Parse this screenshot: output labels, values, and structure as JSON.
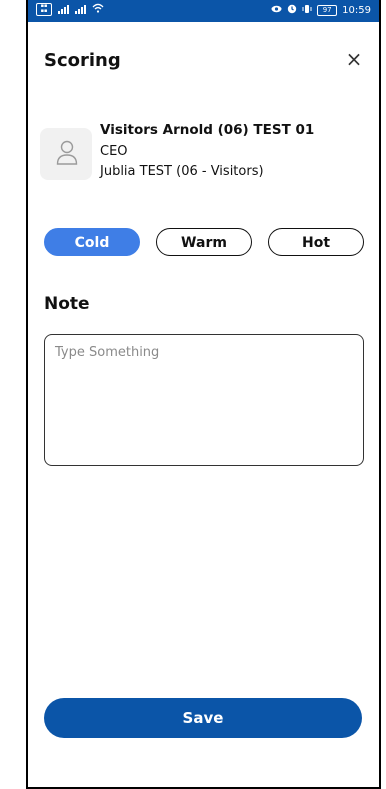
{
  "status_bar": {
    "time": "10:59",
    "battery": "97"
  },
  "header": {
    "title": "Scoring",
    "close_glyph": "×"
  },
  "contact": {
    "name": "Visitors Arnold (06) TEST 01",
    "role": "CEO",
    "company": "Jublia TEST (06 - Visitors)"
  },
  "scoring": {
    "options": [
      {
        "label": "Cold",
        "selected": true
      },
      {
        "label": "Warm",
        "selected": false
      },
      {
        "label": "Hot",
        "selected": false
      }
    ]
  },
  "note": {
    "label": "Note",
    "placeholder": "Type Something",
    "value": ""
  },
  "footer": {
    "save_label": "Save"
  },
  "colors": {
    "primary": "#0b55a8",
    "chip_active": "#3f7ee6"
  },
  "icons": [
    "close-icon",
    "user-avatar-icon",
    "signal-icon",
    "wifi-icon",
    "battery-icon",
    "eye-icon",
    "alarm-icon"
  ]
}
